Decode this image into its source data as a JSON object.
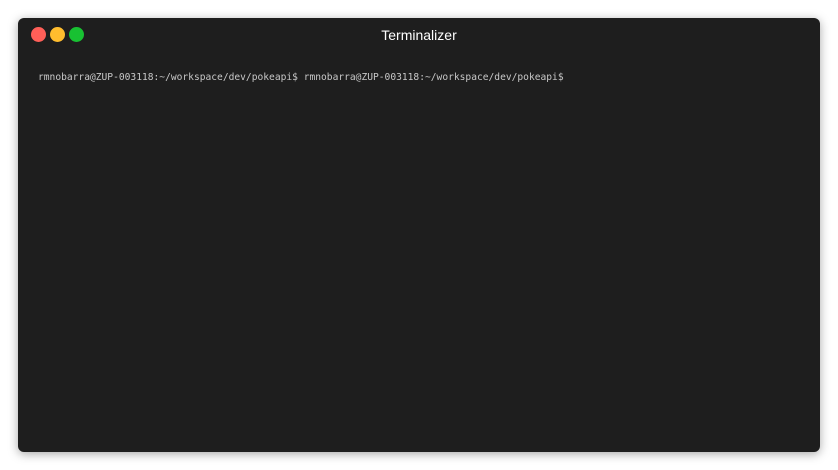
{
  "window": {
    "title": "Terminalizer",
    "controls": {
      "close_color": "#ff5f58",
      "minimize_color": "#ffbd2e",
      "maximize_color": "#18c132"
    },
    "background_color": "#1e1e1e"
  },
  "terminal": {
    "line": "rmnobarra@ZUP-003118:~/workspace/dev/pokeapi$ rmnobarra@ZUP-003118:~/workspace/dev/pokeapi$"
  }
}
